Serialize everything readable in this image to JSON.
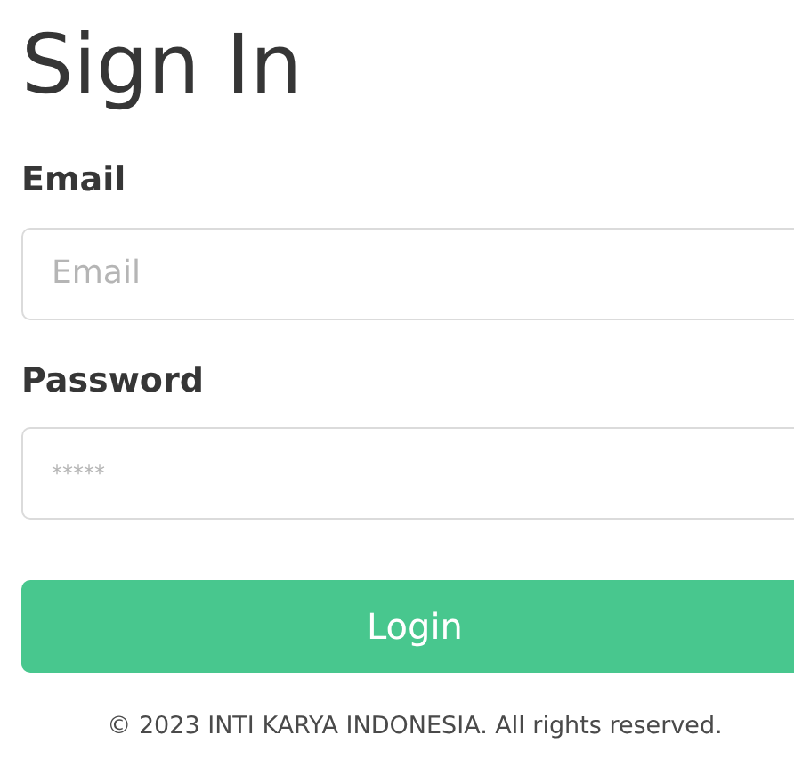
{
  "title": "Sign In",
  "fields": [
    {
      "label": "Email",
      "placeholder": "Email",
      "kind": "email"
    },
    {
      "label": "Password",
      "placeholder": "*****",
      "kind": "password"
    }
  ],
  "button": "Login",
  "footer": "© 2023 INTI KARYA INDONESIA. All rights reserved."
}
